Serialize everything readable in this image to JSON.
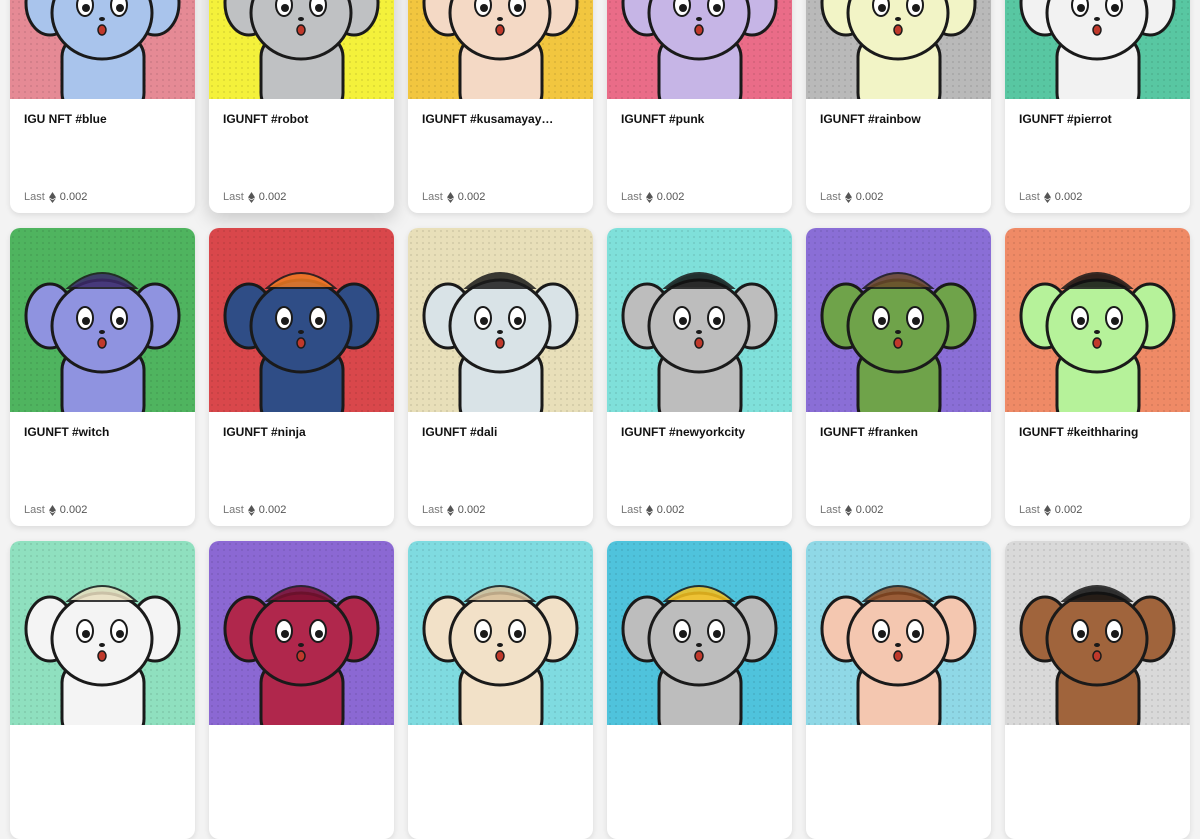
{
  "cards": [
    {
      "title": "IGU NFT #blue",
      "last_label": "Last",
      "price": "0.002",
      "bg": "#e58a95",
      "body": "#a9c4ec",
      "accent": "#3d5a8a",
      "icon": "blue-bear"
    },
    {
      "title": "IGUNFT #robot",
      "last_label": "Last",
      "price": "0.002",
      "bg": "#f4f13b",
      "body": "#bfc1c3",
      "accent": "#e84b7a",
      "icon": "robot-bear"
    },
    {
      "title": "IGUNFT #kusamayay…",
      "last_label": "Last",
      "price": "0.002",
      "bg": "#f2c63f",
      "body": "#f4d9c5",
      "accent": "#d9262b",
      "icon": "polka-dot-bear"
    },
    {
      "title": "IGUNFT #punk",
      "last_label": "Last",
      "price": "0.002",
      "bg": "#ea6c88",
      "body": "#c6b5e6",
      "accent": "#222222",
      "icon": "punk-bear"
    },
    {
      "title": "IGUNFT #rainbow",
      "last_label": "Last",
      "price": "0.002",
      "bg": "#b9b9b9",
      "body": "#f2f4c6",
      "accent": "#4caf50",
      "icon": "rainbow-bear"
    },
    {
      "title": "IGUNFT #pierrot",
      "last_label": "Last",
      "price": "0.002",
      "bg": "#58c7a2",
      "body": "#f2f2f2",
      "accent": "#e53935",
      "icon": "pierrot-bear"
    },
    {
      "title": "IGUNFT #witch",
      "last_label": "Last",
      "price": "0.002",
      "bg": "#4fb45f",
      "body": "#8f93e0",
      "accent": "#3b2a6a",
      "icon": "witch-bear"
    },
    {
      "title": "IGUNFT #ninja",
      "last_label": "Last",
      "price": "0.002",
      "bg": "#d9474b",
      "body": "#2f4d86",
      "accent": "#ef7a22",
      "icon": "ninja-bear"
    },
    {
      "title": "IGUNFT #dali",
      "last_label": "Last",
      "price": "0.002",
      "bg": "#e8dfb9",
      "body": "#d9e3e7",
      "accent": "#1b1b1b",
      "icon": "dali-bear"
    },
    {
      "title": "IGUNFT #newyorkcity",
      "last_label": "Last",
      "price": "0.002",
      "bg": "#7fe0da",
      "body": "#bdbdbd",
      "accent": "#111111",
      "icon": "newyork-bear"
    },
    {
      "title": "IGUNFT #franken",
      "last_label": "Last",
      "price": "0.002",
      "bg": "#8a6ed6",
      "body": "#6fa34a",
      "accent": "#6b4a2a",
      "icon": "franken-bear"
    },
    {
      "title": "IGUNFT #keithharing",
      "last_label": "Last",
      "price": "0.002",
      "bg": "#ef8a66",
      "body": "#b6f29a",
      "accent": "#111111",
      "icon": "keithharing-bear"
    },
    {
      "title": "",
      "last_label": "",
      "price": "",
      "bg": "#8fe0bf",
      "body": "#f4f4f4",
      "accent": "#e9dfc0",
      "icon": "cream-bear"
    },
    {
      "title": "",
      "last_label": "",
      "price": "",
      "bg": "#8b68d3",
      "body": "#b0274c",
      "accent": "#7a1030",
      "icon": "devil-bear"
    },
    {
      "title": "",
      "last_label": "",
      "price": "",
      "bg": "#7fdbe0",
      "body": "#f2e1c8",
      "accent": "#d8c09a",
      "icon": "glasses-bear"
    },
    {
      "title": "",
      "last_label": "",
      "price": "",
      "bg": "#4fc3dc",
      "body": "#bdbdbd",
      "accent": "#f7c31e",
      "icon": "egg-bear"
    },
    {
      "title": "",
      "last_label": "",
      "price": "",
      "bg": "#8fd8e6",
      "body": "#f4c7b0",
      "accent": "#8a4a22",
      "icon": "angel-bear"
    },
    {
      "title": "",
      "last_label": "",
      "price": "",
      "bg": "#d9d9d9",
      "body": "#a0643c",
      "accent": "#111111",
      "icon": "mickey-bear"
    }
  ]
}
